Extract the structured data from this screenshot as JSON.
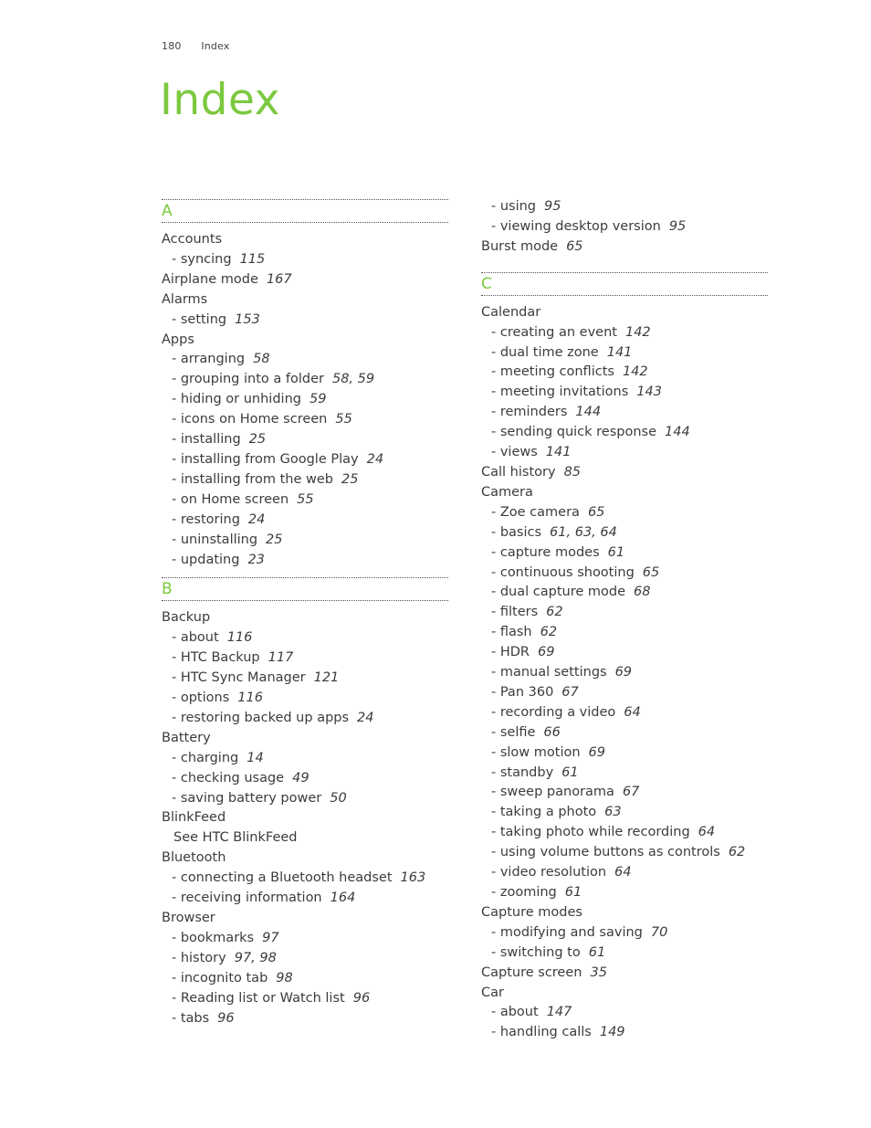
{
  "header": {
    "page_number": "180",
    "section": "Index"
  },
  "title": "Index",
  "accent_color": "#7cc93f",
  "columns": [
    {
      "sections": [
        {
          "letter": "A",
          "entries": [
            {
              "text": "Accounts",
              "pages": "",
              "level": "main"
            },
            {
              "text": "- syncing",
              "pages": "115",
              "level": "sub"
            },
            {
              "text": "Airplane mode",
              "pages": "167",
              "level": "main"
            },
            {
              "text": "Alarms",
              "pages": "",
              "level": "main"
            },
            {
              "text": "- setting",
              "pages": "153",
              "level": "sub"
            },
            {
              "text": "Apps",
              "pages": "",
              "level": "main"
            },
            {
              "text": "- arranging",
              "pages": "58",
              "level": "sub"
            },
            {
              "text": "- grouping into a folder",
              "pages": "58, 59",
              "level": "sub"
            },
            {
              "text": "- hiding or unhiding",
              "pages": "59",
              "level": "sub"
            },
            {
              "text": "- icons on Home screen",
              "pages": "55",
              "level": "sub"
            },
            {
              "text": "- installing",
              "pages": "25",
              "level": "sub"
            },
            {
              "text": "- installing from Google Play",
              "pages": "24",
              "level": "sub"
            },
            {
              "text": "- installing from the web",
              "pages": "25",
              "level": "sub"
            },
            {
              "text": "- on Home screen",
              "pages": "55",
              "level": "sub"
            },
            {
              "text": "- restoring",
              "pages": "24",
              "level": "sub"
            },
            {
              "text": "- uninstalling",
              "pages": "25",
              "level": "sub"
            },
            {
              "text": "- updating",
              "pages": "23",
              "level": "sub"
            }
          ]
        },
        {
          "letter": "B",
          "entries": [
            {
              "text": "Backup",
              "pages": "",
              "level": "main"
            },
            {
              "text": "- about",
              "pages": "116",
              "level": "sub"
            },
            {
              "text": "- HTC Backup",
              "pages": "117",
              "level": "sub"
            },
            {
              "text": "- HTC Sync Manager",
              "pages": "121",
              "level": "sub"
            },
            {
              "text": "- options",
              "pages": "116",
              "level": "sub"
            },
            {
              "text": "- restoring backed up apps",
              "pages": "24",
              "level": "sub"
            },
            {
              "text": "Battery",
              "pages": "",
              "level": "main"
            },
            {
              "text": "- charging",
              "pages": "14",
              "level": "sub"
            },
            {
              "text": "- checking usage",
              "pages": "49",
              "level": "sub"
            },
            {
              "text": "- saving battery power",
              "pages": "50",
              "level": "sub"
            },
            {
              "text": "BlinkFeed",
              "pages": "",
              "level": "main"
            },
            {
              "text": "See HTC BlinkFeed",
              "pages": "",
              "level": "see"
            },
            {
              "text": "Bluetooth",
              "pages": "",
              "level": "main"
            },
            {
              "text": "- connecting a Bluetooth headset",
              "pages": "163",
              "level": "sub"
            },
            {
              "text": "- receiving information",
              "pages": "164",
              "level": "sub"
            },
            {
              "text": "Browser",
              "pages": "",
              "level": "main"
            },
            {
              "text": "- bookmarks",
              "pages": "97",
              "level": "sub"
            },
            {
              "text": "- history",
              "pages": "97, 98",
              "level": "sub"
            },
            {
              "text": "- incognito tab",
              "pages": "98",
              "level": "sub"
            },
            {
              "text": "- Reading list or Watch list",
              "pages": "96",
              "level": "sub"
            },
            {
              "text": "- tabs",
              "pages": "96",
              "level": "sub"
            }
          ]
        }
      ]
    },
    {
      "sections": [
        {
          "letter": "",
          "entries": [
            {
              "text": "- using",
              "pages": "95",
              "level": "sub"
            },
            {
              "text": "- viewing desktop version",
              "pages": "95",
              "level": "sub"
            },
            {
              "text": "Burst mode",
              "pages": "65",
              "level": "main"
            }
          ]
        },
        {
          "letter": "C",
          "entries": [
            {
              "text": "Calendar",
              "pages": "",
              "level": "main"
            },
            {
              "text": "- creating an event",
              "pages": "142",
              "level": "sub"
            },
            {
              "text": "- dual time zone",
              "pages": "141",
              "level": "sub"
            },
            {
              "text": "- meeting conflicts",
              "pages": "142",
              "level": "sub"
            },
            {
              "text": "- meeting invitations",
              "pages": "143",
              "level": "sub"
            },
            {
              "text": "- reminders",
              "pages": "144",
              "level": "sub"
            },
            {
              "text": "- sending quick response",
              "pages": "144",
              "level": "sub"
            },
            {
              "text": "- views",
              "pages": "141",
              "level": "sub"
            },
            {
              "text": "Call history",
              "pages": "85",
              "level": "main"
            },
            {
              "text": "Camera",
              "pages": "",
              "level": "main"
            },
            {
              "text": "- Zoe camera",
              "pages": "65",
              "level": "sub"
            },
            {
              "text": "- basics",
              "pages": "61, 63, 64",
              "level": "sub"
            },
            {
              "text": "- capture modes",
              "pages": "61",
              "level": "sub"
            },
            {
              "text": "- continuous shooting",
              "pages": "65",
              "level": "sub"
            },
            {
              "text": "- dual capture mode",
              "pages": "68",
              "level": "sub"
            },
            {
              "text": "- filters",
              "pages": "62",
              "level": "sub"
            },
            {
              "text": "- flash",
              "pages": "62",
              "level": "sub"
            },
            {
              "text": "- HDR",
              "pages": "69",
              "level": "sub"
            },
            {
              "text": "- manual settings",
              "pages": "69",
              "level": "sub"
            },
            {
              "text": "- Pan 360",
              "pages": "67",
              "level": "sub"
            },
            {
              "text": "- recording a video",
              "pages": "64",
              "level": "sub"
            },
            {
              "text": "- selfie",
              "pages": "66",
              "level": "sub"
            },
            {
              "text": "- slow motion",
              "pages": "69",
              "level": "sub"
            },
            {
              "text": "- standby",
              "pages": "61",
              "level": "sub"
            },
            {
              "text": "- sweep panorama",
              "pages": "67",
              "level": "sub"
            },
            {
              "text": "- taking a photo",
              "pages": "63",
              "level": "sub"
            },
            {
              "text": "- taking photo while recording",
              "pages": "64",
              "level": "sub"
            },
            {
              "text": "- using volume buttons as controls",
              "pages": "62",
              "level": "sub"
            },
            {
              "text": "- video resolution",
              "pages": "64",
              "level": "sub"
            },
            {
              "text": "- zooming",
              "pages": "61",
              "level": "sub"
            },
            {
              "text": "Capture modes",
              "pages": "",
              "level": "main"
            },
            {
              "text": "- modifying and saving",
              "pages": "70",
              "level": "sub"
            },
            {
              "text": "- switching to",
              "pages": "61",
              "level": "sub"
            },
            {
              "text": "Capture screen",
              "pages": "35",
              "level": "main"
            },
            {
              "text": "Car",
              "pages": "",
              "level": "main"
            },
            {
              "text": "- about",
              "pages": "147",
              "level": "sub"
            },
            {
              "text": "- handling calls",
              "pages": "149",
              "level": "sub"
            }
          ]
        }
      ]
    }
  ]
}
